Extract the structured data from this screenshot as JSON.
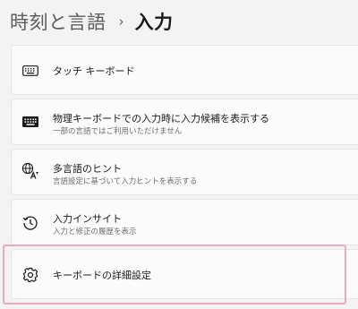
{
  "breadcrumb": {
    "parent": "時刻と言語",
    "separator": "›",
    "current": "入力"
  },
  "items": [
    {
      "title": "タッチ キーボード",
      "subtitle": "",
      "icon": "touch-keyboard-icon"
    },
    {
      "title": "物理キーボードでの入力時に入力候補を表示する",
      "subtitle": "一部の言語ではご利用いただけません",
      "icon": "keyboard-icon"
    },
    {
      "title": "多言語のヒント",
      "subtitle": "言語設定に基づいて入力ヒントを表示する",
      "icon": "language-icon"
    },
    {
      "title": "入力インサイト",
      "subtitle": "入力と修正の履歴を表示",
      "icon": "history-icon"
    },
    {
      "title": "キーボードの詳細設定",
      "subtitle": "",
      "icon": "gear-icon"
    }
  ],
  "colors": {
    "background": "#f3f3f3",
    "card": "#fbfbfb",
    "highlight": "#e9a8c4"
  }
}
